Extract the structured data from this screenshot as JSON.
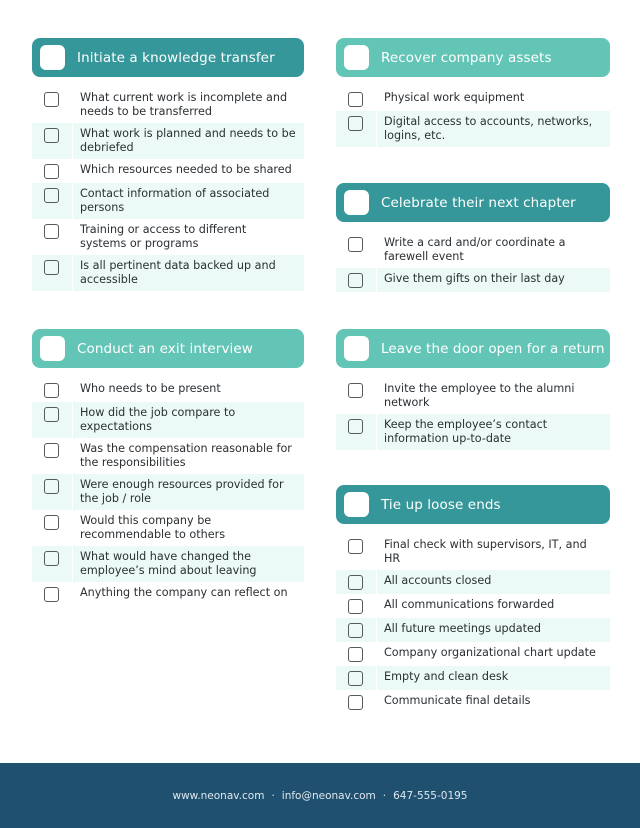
{
  "colors": {
    "header_dark": "#36979a",
    "header_light": "#63c5b6",
    "stripe": "#ebfaf7",
    "footer": "#1f506f"
  },
  "sections": {
    "knowledge": {
      "title": "Initiate a knowledge transfer",
      "items": [
        "What current work is incomplete and needs to be transferred",
        "What work is planned and needs to be debriefed",
        "Which resources needed to be shared",
        "Contact information of associated persons",
        "Training or access to different systems or programs",
        "Is all pertinent data backed up and accessible"
      ]
    },
    "interview": {
      "title": "Conduct an exit interview",
      "items": [
        "Who needs to be present",
        "How did the job compare to expectations",
        "Was the compensation reasonable for the responsibilities",
        "Were enough resources provided for the job / role",
        "Would this company be recommendable to others",
        "What would have changed the employee’s mind about leaving",
        "Anything the company can reflect on"
      ]
    },
    "assets": {
      "title": "Recover company assets",
      "items": [
        "Physical work equipment",
        "Digital access to accounts, networks, logins, etc."
      ]
    },
    "celebrate": {
      "title": "Celebrate their next chapter",
      "items": [
        "Write a card and/or coordinate a farewell event",
        "Give them gifts on their last day"
      ]
    },
    "door": {
      "title": "Leave the door open for a return",
      "items": [
        "Invite the employee to the alumni network",
        "Keep the employee’s contact information up-to-date"
      ]
    },
    "loose": {
      "title": "Tie up loose ends",
      "items": [
        "Final check with supervisors, IT, and HR",
        "All accounts closed",
        "All communications forwarded",
        "All future meetings updated",
        "Company organizational chart update",
        "Empty and clean desk",
        "Communicate final details"
      ]
    }
  },
  "footer": {
    "website": "www.neonav.com",
    "email": "info@neonav.com",
    "phone": "647-555-0195",
    "separator": "·"
  }
}
